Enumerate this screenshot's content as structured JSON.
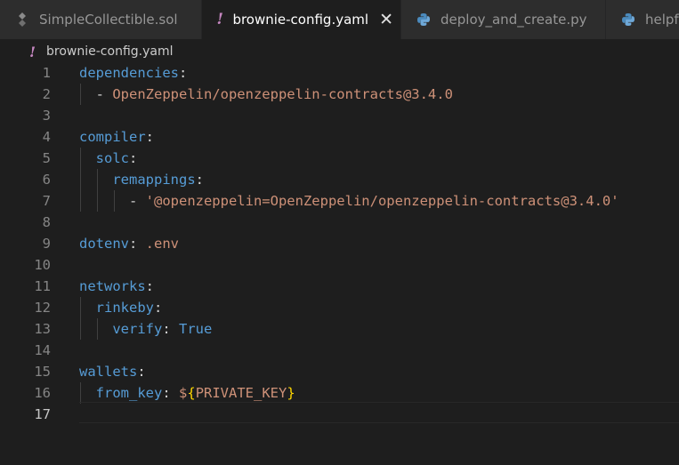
{
  "tabs": [
    {
      "label": "SimpleCollectible.sol",
      "icon": "solidity-file-icon",
      "active": false
    },
    {
      "label": "brownie-config.yaml",
      "icon": "yaml-file-icon",
      "active": true
    },
    {
      "label": "deploy_and_create.py",
      "icon": "python-file-icon",
      "active": false
    },
    {
      "label": "helpfu",
      "icon": "python-file-icon",
      "active": false
    }
  ],
  "tab_icons": {
    "yaml": "!",
    "close": "✕"
  },
  "breadcrumb": {
    "file": "brownie-config.yaml"
  },
  "editor": {
    "current_line": 17,
    "lines": [
      {
        "n": "1",
        "t": [
          [
            "k",
            "dependencies"
          ],
          [
            "p",
            ":"
          ]
        ]
      },
      {
        "n": "2",
        "t": [
          [
            "p",
            "  - "
          ],
          [
            "s",
            "OpenZeppelin/openzeppelin-contracts@3.4.0"
          ]
        ]
      },
      {
        "n": "3",
        "t": []
      },
      {
        "n": "4",
        "t": [
          [
            "k",
            "compiler"
          ],
          [
            "p",
            ":"
          ]
        ]
      },
      {
        "n": "5",
        "t": [
          [
            "p",
            "  "
          ],
          [
            "k",
            "solc"
          ],
          [
            "p",
            ":"
          ]
        ]
      },
      {
        "n": "6",
        "t": [
          [
            "p",
            "    "
          ],
          [
            "k",
            "remappings"
          ],
          [
            "p",
            ":"
          ]
        ]
      },
      {
        "n": "7",
        "t": [
          [
            "p",
            "      - "
          ],
          [
            "s",
            "'@openzeppelin=OpenZeppelin/openzeppelin-contracts@3.4.0'"
          ]
        ]
      },
      {
        "n": "8",
        "t": []
      },
      {
        "n": "9",
        "t": [
          [
            "k",
            "dotenv"
          ],
          [
            "p",
            ": "
          ],
          [
            "s",
            ".env"
          ]
        ]
      },
      {
        "n": "10",
        "t": []
      },
      {
        "n": "11",
        "t": [
          [
            "k",
            "networks"
          ],
          [
            "p",
            ":"
          ]
        ]
      },
      {
        "n": "12",
        "t": [
          [
            "p",
            "  "
          ],
          [
            "k",
            "rinkeby"
          ],
          [
            "p",
            ":"
          ]
        ]
      },
      {
        "n": "13",
        "t": [
          [
            "p",
            "    "
          ],
          [
            "k",
            "verify"
          ],
          [
            "p",
            ": "
          ],
          [
            "b",
            "True"
          ]
        ]
      },
      {
        "n": "14",
        "t": []
      },
      {
        "n": "15",
        "t": [
          [
            "k",
            "wallets"
          ],
          [
            "p",
            ":"
          ]
        ]
      },
      {
        "n": "16",
        "t": [
          [
            "p",
            "  "
          ],
          [
            "k",
            "from_key"
          ],
          [
            "p",
            ": "
          ],
          [
            "s",
            "$"
          ],
          [
            "brace",
            "{"
          ],
          [
            "s",
            "PRIVATE_KEY"
          ],
          [
            "brace",
            "}"
          ]
        ]
      },
      {
        "n": "17",
        "t": []
      }
    ]
  },
  "colors": {
    "key": "#569cd6",
    "string": "#ce9178",
    "boolean": "#569cd6",
    "brace": "#ffd700",
    "yaml_icon": "#c586c0",
    "python_icon": "#4b8bbe"
  }
}
